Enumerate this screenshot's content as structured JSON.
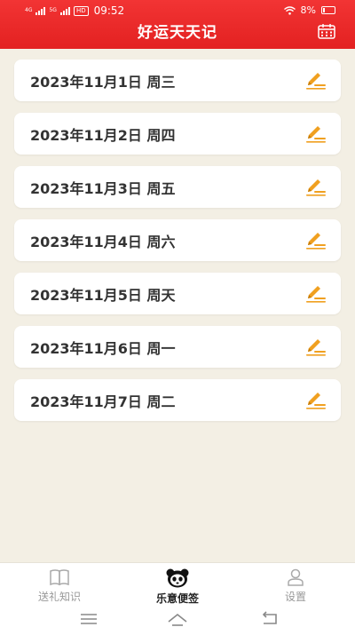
{
  "status": {
    "signal_1": "4G",
    "signal_2": "5G",
    "hd": "HD",
    "time": "09:52",
    "battery": "8%"
  },
  "header": {
    "title": "好运天天记",
    "calendar_icon": "calendar-icon"
  },
  "entries": [
    {
      "date": "2023年11月1日 周三",
      "icon": "pencil-edit-icon"
    },
    {
      "date": "2023年11月2日 周四",
      "icon": "pencil-edit-icon"
    },
    {
      "date": "2023年11月3日 周五",
      "icon": "pencil-edit-icon"
    },
    {
      "date": "2023年11月4日 周六",
      "icon": "pencil-edit-icon"
    },
    {
      "date": "2023年11月5日 周天",
      "icon": "pencil-edit-icon"
    },
    {
      "date": "2023年11月6日 周一",
      "icon": "pencil-edit-icon"
    },
    {
      "date": "2023年11月7日 周二",
      "icon": "pencil-edit-icon"
    }
  ],
  "tabs": [
    {
      "label": "送礼知识",
      "icon": "book-icon",
      "active": false
    },
    {
      "label": "乐意便签",
      "icon": "panda-icon",
      "active": true
    },
    {
      "label": "设置",
      "icon": "person-icon",
      "active": false
    }
  ],
  "system_nav": [
    "menu-icon",
    "home-icon",
    "back-icon"
  ],
  "colors": {
    "accent": "#e62b2b",
    "background": "#f3efe4",
    "edit_icon": "#f0a020"
  }
}
